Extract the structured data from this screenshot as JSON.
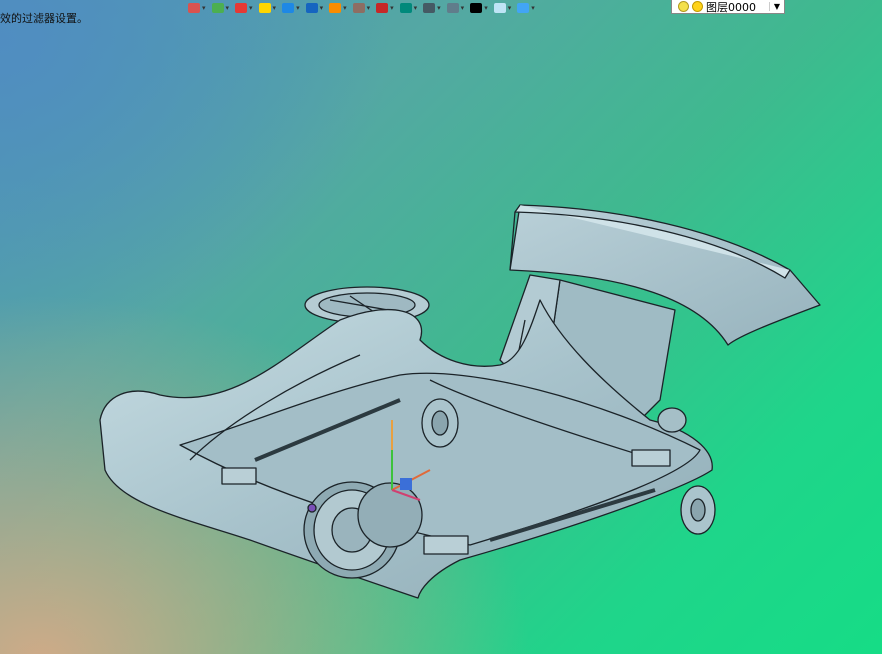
{
  "status": {
    "message": "效的过滤器设置。"
  },
  "toolbar": {
    "buttons": [
      {
        "icon": "undo-icon",
        "color": "#d9534f"
      },
      {
        "icon": "snap-icon",
        "color": "#4caf50"
      },
      {
        "icon": "pencil-icon",
        "color": "#e53935"
      },
      {
        "icon": "highlighter-icon",
        "color": "#ffd600"
      },
      {
        "icon": "solid-box-icon",
        "color": "#1e88e5"
      },
      {
        "icon": "shaded-box-icon",
        "color": "#1565c0"
      },
      {
        "icon": "render-icon",
        "color": "#fb8c00"
      },
      {
        "icon": "zoom-icon",
        "color": "#8d6e63"
      },
      {
        "icon": "pan-icon",
        "color": "#c62828"
      },
      {
        "icon": "view-icon",
        "color": "#00897b"
      },
      {
        "icon": "frame-icon",
        "color": "#455a64"
      },
      {
        "icon": "layout-icon",
        "color": "#607d8b"
      },
      {
        "icon": "line-color-icon",
        "color": "#000000"
      },
      {
        "icon": "fill-color-icon",
        "color": "#bfe4f5"
      },
      {
        "icon": "layers-icon",
        "color": "#42a5f5"
      }
    ]
  },
  "layer_combo": {
    "value": "图层0000"
  },
  "model": {
    "body_color": "#a8c3cc",
    "edge_color": "#1b2328"
  }
}
